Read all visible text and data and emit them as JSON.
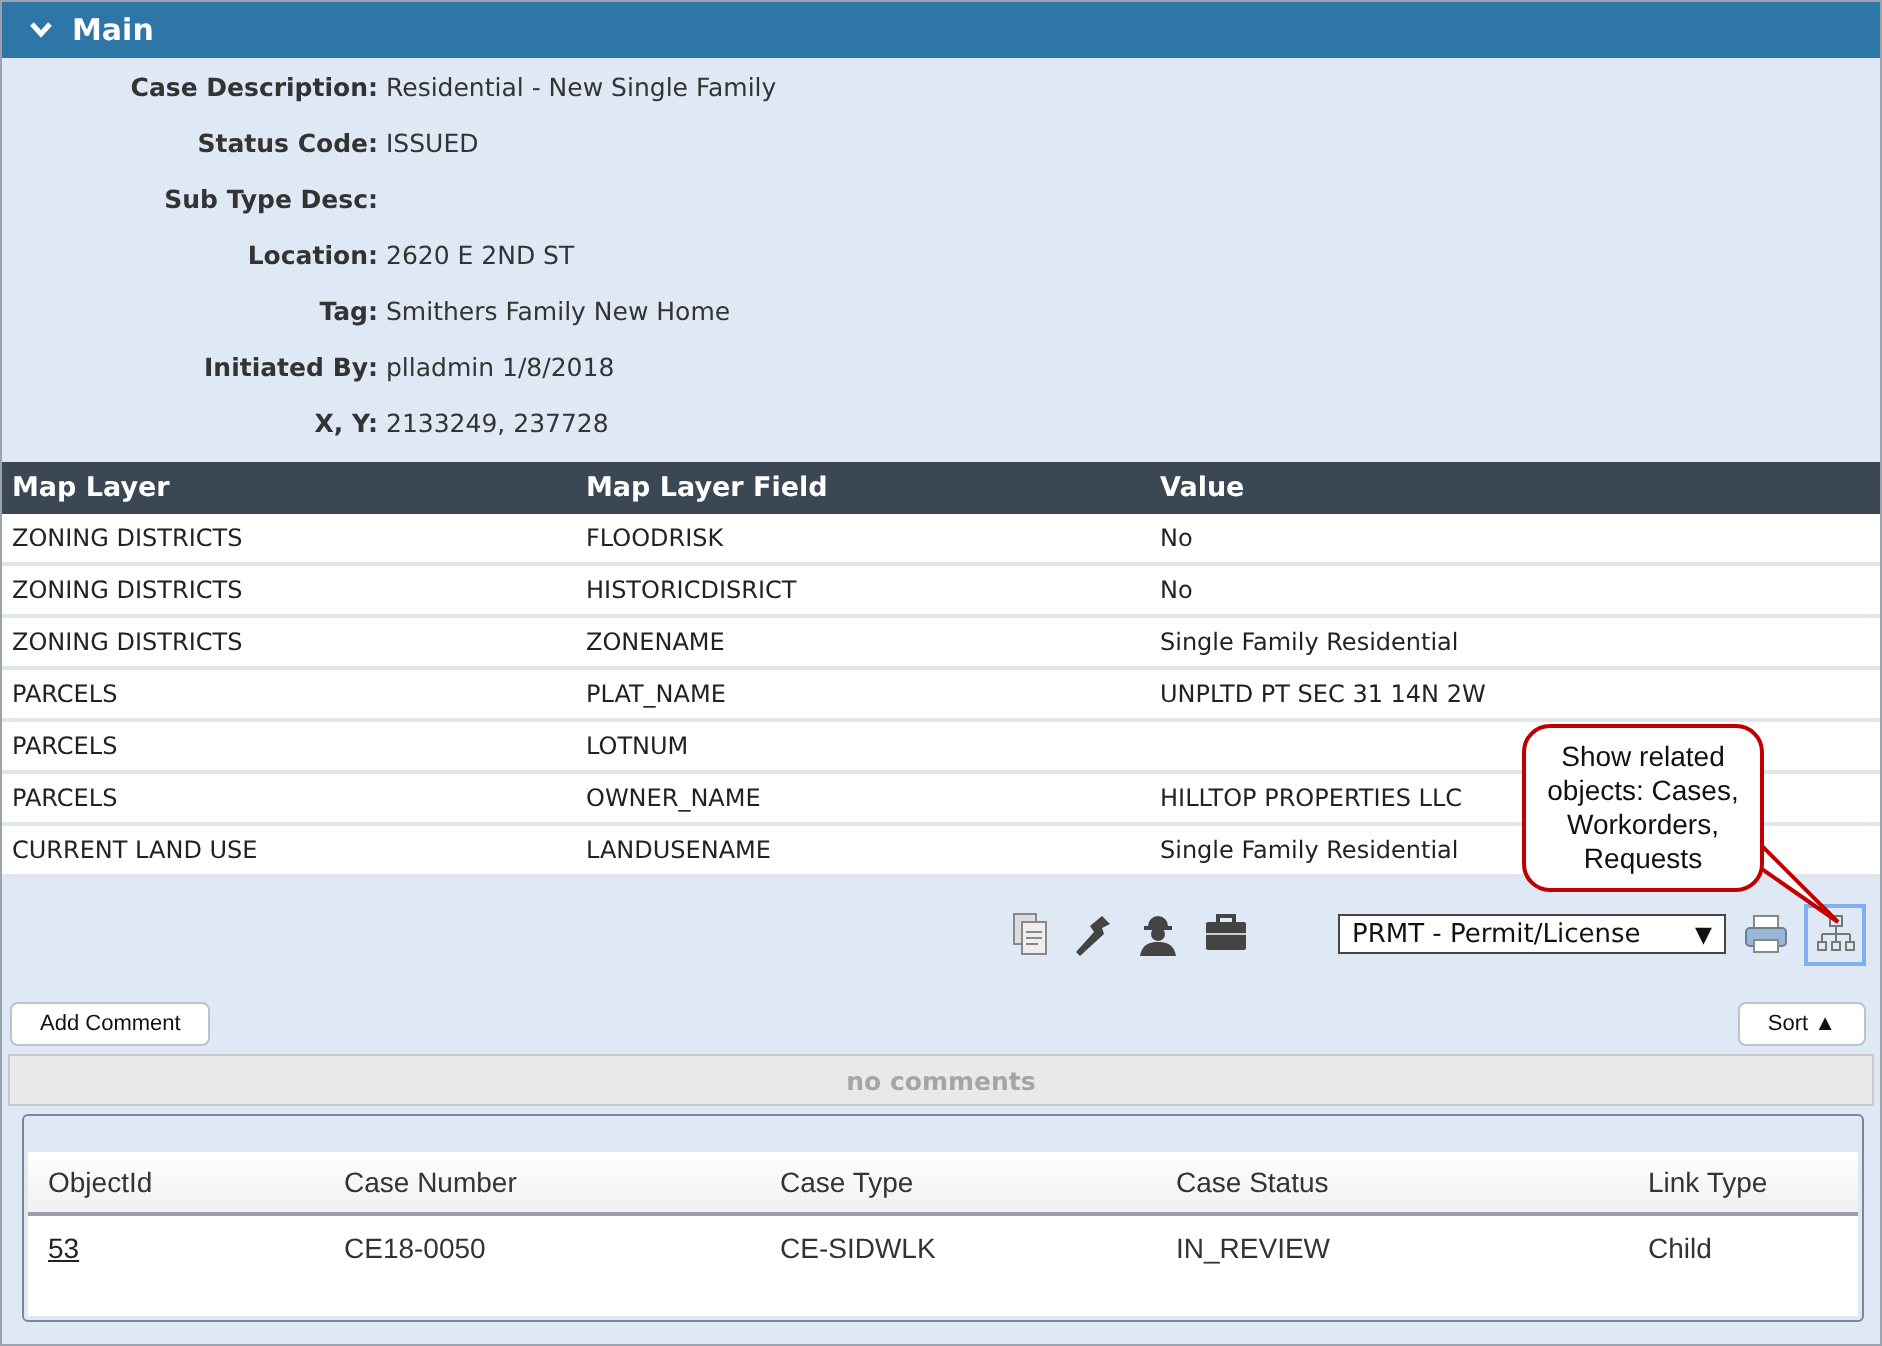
{
  "section": {
    "title": "Main",
    "expanded": true
  },
  "fields": [
    {
      "label": "Case Description:",
      "value": "Residential - New Single Family"
    },
    {
      "label": "Status Code:",
      "value": "ISSUED"
    },
    {
      "label": "Sub Type Desc:"
    },
    {
      "label": "Location:",
      "value": "2620 E 2ND ST"
    },
    {
      "label": "Tag:",
      "value": "Smithers Family New Home"
    },
    {
      "label": "Initiated By:",
      "value": "plladmin 1/8/2018"
    },
    {
      "label": "X, Y:",
      "value": "2133249, 237728"
    }
  ],
  "map_table": {
    "columns": [
      "Map Layer",
      "Map Layer Field",
      "Value"
    ],
    "rows": [
      [
        "ZONING DISTRICTS",
        "FLOODRISK",
        "No"
      ],
      [
        "ZONING DISTRICTS",
        "HISTORICDISRICT",
        "No"
      ],
      [
        "ZONING DISTRICTS",
        "ZONENAME",
        "Single Family Residential"
      ],
      [
        "PARCELS",
        "PLAT_NAME",
        "UNPLTD PT SEC 31 14N 2W"
      ],
      [
        "PARCELS",
        "LOTNUM",
        null
      ],
      [
        "PARCELS",
        "OWNER_NAME",
        "HILLTOP PROPERTIES LLC"
      ],
      [
        "CURRENT LAND USE",
        "LANDUSENAME",
        "Single Family Residential"
      ]
    ]
  },
  "toolbar": {
    "tools": [
      {
        "kind": "copy"
      },
      {
        "kind": "wrench"
      },
      {
        "kind": "worker"
      },
      {
        "kind": "briefcase"
      }
    ],
    "select": {
      "value": "PRMT - Permit/License",
      "caret": "▼"
    },
    "related_selected": true
  },
  "callout": "Show related objects: Cases, Workorders, Requests",
  "comments": {
    "add_button": "Add Comment",
    "sort_button": "Sort ▲",
    "empty": "no comments"
  },
  "related_table": {
    "columns": [
      "ObjectId",
      "Case Number",
      "Case Type",
      "Case Status",
      "Link Type"
    ],
    "rows": [
      [
        "53",
        "CE18-0050",
        "CE-SIDWLK",
        "IN_REVIEW",
        "Child"
      ]
    ]
  }
}
